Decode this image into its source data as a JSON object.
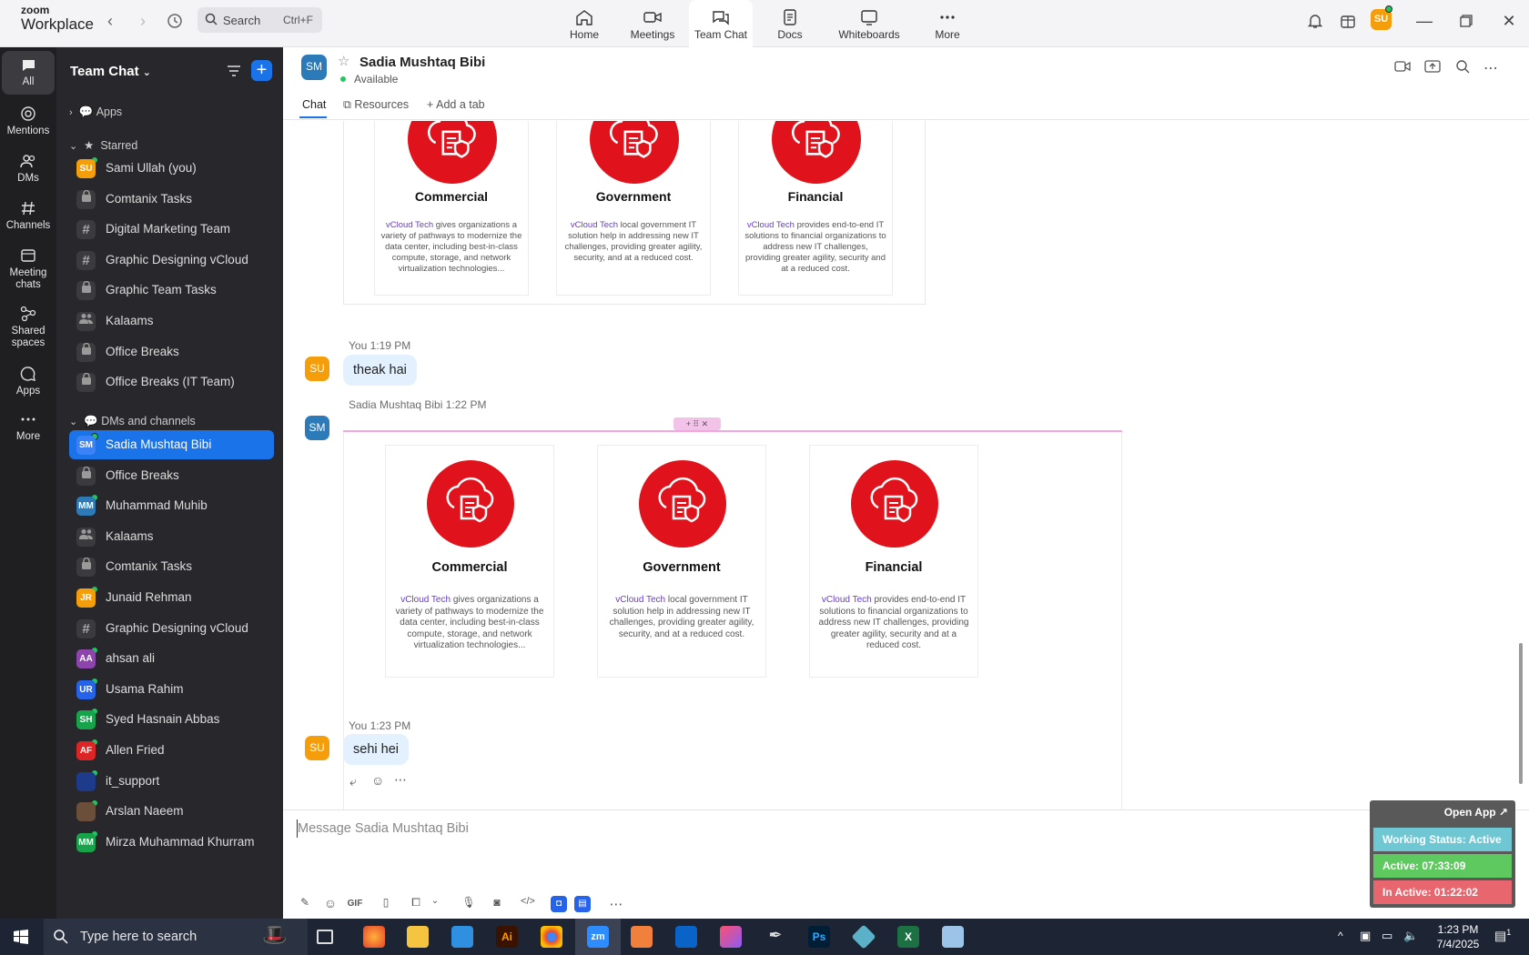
{
  "app": {
    "brand_line1": "zoom",
    "brand_line2": "Workplace"
  },
  "search": {
    "label": "Search",
    "shortcut": "Ctrl+F"
  },
  "top_tabs": [
    {
      "label": "Home"
    },
    {
      "label": "Meetings"
    },
    {
      "label": "Team Chat"
    },
    {
      "label": "Docs"
    },
    {
      "label": "Whiteboards"
    },
    {
      "label": "More"
    }
  ],
  "user_avatar": "SU",
  "rail": [
    {
      "label": "All"
    },
    {
      "label": "Mentions"
    },
    {
      "label": "DMs"
    },
    {
      "label": "Channels"
    },
    {
      "label": "Meeting chats"
    },
    {
      "label": "Shared spaces"
    },
    {
      "label": "Apps"
    },
    {
      "label": "More"
    }
  ],
  "sidebar": {
    "title": "Team Chat",
    "apps_label": "Apps",
    "starred_label": "Starred",
    "starred": [
      {
        "initials": "SU",
        "label": "Sami Ullah (you)",
        "kind": "avatar",
        "color": "#f59e0b"
      },
      {
        "label": "Comtanix Tasks",
        "kind": "lock"
      },
      {
        "label": "Digital Marketing Team",
        "kind": "hash"
      },
      {
        "label": "Graphic Designing vCloud",
        "kind": "hash"
      },
      {
        "label": "Graphic Team Tasks",
        "kind": "lock"
      },
      {
        "label": "Kalaams",
        "kind": "group"
      },
      {
        "label": "Office Breaks",
        "kind": "lock"
      },
      {
        "label": "Office Breaks (IT Team)",
        "kind": "lock"
      }
    ],
    "dms_label": "DMs and channels",
    "dms": [
      {
        "initials": "SM",
        "label": "Sadia Mushtaq Bibi",
        "kind": "avatar",
        "color": "#3b82f6",
        "selected": true
      },
      {
        "label": "Office Breaks",
        "kind": "lock"
      },
      {
        "initials": "MM",
        "label": "Muhammad Muhib",
        "kind": "avatar",
        "color": "#2d7ab8"
      },
      {
        "label": "Kalaams",
        "kind": "group"
      },
      {
        "label": "Comtanix Tasks",
        "kind": "lock"
      },
      {
        "initials": "JR",
        "label": "Junaid Rehman",
        "kind": "avatar",
        "color": "#f59e0b"
      },
      {
        "label": "Graphic Designing vCloud",
        "kind": "hash"
      },
      {
        "initials": "AA",
        "label": "ahsan ali",
        "kind": "avatar",
        "color": "#8e44ad"
      },
      {
        "initials": "UR",
        "label": "Usama Rahim",
        "kind": "avatar",
        "color": "#2563eb"
      },
      {
        "initials": "SH",
        "label": "Syed Hasnain Abbas",
        "kind": "avatar",
        "color": "#16a34a"
      },
      {
        "initials": "AF",
        "label": "Allen Fried",
        "kind": "avatar",
        "color": "#dc2626"
      },
      {
        "initials": "",
        "label": "it_support",
        "kind": "avatar",
        "color": "#1e3a8a"
      },
      {
        "initials": "",
        "label": "Arslan Naeem",
        "kind": "avatar",
        "color": "#6b4f3a"
      },
      {
        "initials": "MM",
        "label": "Mirza Muhammad Khurram",
        "kind": "avatar",
        "color": "#16a34a"
      }
    ]
  },
  "chat": {
    "contact_initials": "SM",
    "contact_name": "Sadia Mushtaq Bibi",
    "status": "Available",
    "tabs": [
      {
        "label": "Chat"
      },
      {
        "label": "Resources"
      },
      {
        "label": "Add a tab"
      }
    ],
    "cards": [
      {
        "title": "Commercial",
        "brand": "vCloud Tech",
        "desc": "gives organizations a variety of pathways to modernize the data center, including best-in-class compute, storage, and network virtualization technologies..."
      },
      {
        "title": "Government",
        "brand": "vCloud Tech",
        "desc": "local government IT solution help in addressing new IT challenges, providing greater agility, security, and at a reduced cost."
      },
      {
        "title": "Financial",
        "brand": "vCloud Tech",
        "desc": "provides end-to-end IT solutions to financial organizations to address new IT challenges, providing greater agility, security and at a reduced cost."
      }
    ],
    "messages": [
      {
        "sender": "You",
        "time": "1:19 PM",
        "initials": "SU",
        "text": "theak hai"
      },
      {
        "sender": "Sadia Mushtaq Bibi",
        "time": "1:22 PM",
        "initials": "SM"
      },
      {
        "sender": "You",
        "time": "1:23 PM",
        "initials": "SU",
        "text": "sehi hei"
      }
    ],
    "compose_placeholder": "Message Sadia Mushtaq Bibi",
    "gif_label": "GIF"
  },
  "widget": {
    "open_app": "Open App ↗",
    "working_status": "Working Status: Active",
    "active": "Active: 07:33:09",
    "inactive": "In Active: 01:22:02"
  },
  "taskbar": {
    "search_placeholder": "Type here to search",
    "time": "1:23 PM",
    "date": "7/4/2025",
    "notif_count": "1"
  },
  "colors": {
    "accent": "#1a73e8",
    "card_red": "#e0121b",
    "bubble": "#e3f0fe"
  }
}
